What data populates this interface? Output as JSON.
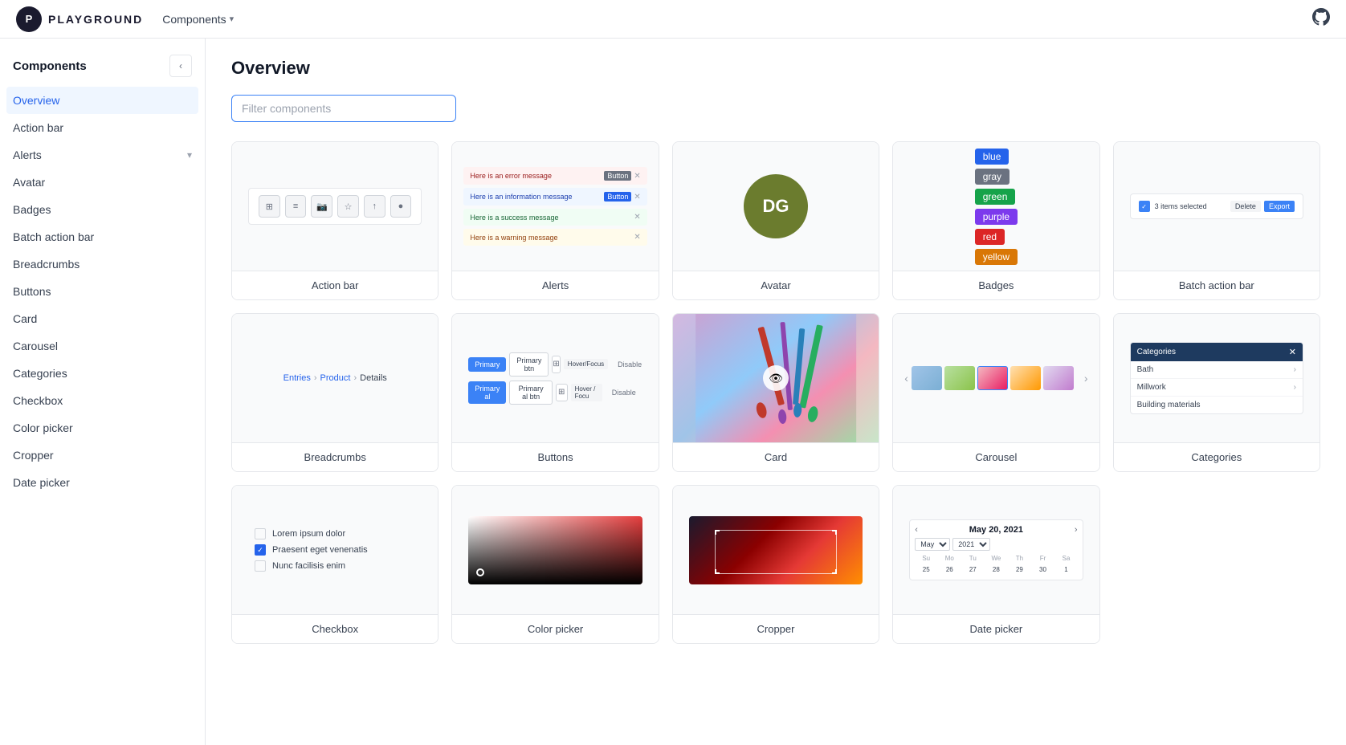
{
  "topnav": {
    "logo_text": "P",
    "brand": "PLAYGROUND",
    "nav_item": "Components",
    "nav_chevron": "▾"
  },
  "sidebar": {
    "title": "Components",
    "items": [
      {
        "label": "Overview",
        "active": true
      },
      {
        "label": "Action bar",
        "active": false
      },
      {
        "label": "Alerts",
        "active": false,
        "has_chevron": true
      },
      {
        "label": "Avatar",
        "active": false
      },
      {
        "label": "Badges",
        "active": false
      },
      {
        "label": "Batch action bar",
        "active": false
      },
      {
        "label": "Breadcrumbs",
        "active": false
      },
      {
        "label": "Buttons",
        "active": false
      },
      {
        "label": "Card",
        "active": false
      },
      {
        "label": "Carousel",
        "active": false
      },
      {
        "label": "Categories",
        "active": false
      },
      {
        "label": "Checkbox",
        "active": false
      },
      {
        "label": "Color picker",
        "active": false
      },
      {
        "label": "Cropper",
        "active": false
      },
      {
        "label": "Date picker",
        "active": false
      }
    ]
  },
  "content": {
    "title": "Overview",
    "filter_placeholder": "Filter components",
    "cards": [
      {
        "label": "Action bar"
      },
      {
        "label": "Alerts"
      },
      {
        "label": "Avatar"
      },
      {
        "label": "Badges"
      },
      {
        "label": "Batch action bar"
      },
      {
        "label": "Breadcrumbs"
      },
      {
        "label": "Buttons"
      },
      {
        "label": "Card"
      },
      {
        "label": "Carousel"
      },
      {
        "label": "Categories"
      },
      {
        "label": "Checkbox"
      },
      {
        "label": "Color picker"
      },
      {
        "label": "Cropper"
      },
      {
        "label": "Date picker"
      }
    ]
  },
  "previews": {
    "avatar_initials": "DG",
    "badges": [
      "blue",
      "gray",
      "green",
      "purple",
      "red",
      "yellow"
    ],
    "alerts": [
      {
        "type": "error",
        "text": "Here is an error message",
        "has_btn": false
      },
      {
        "type": "info",
        "text": "Here is an information message",
        "has_btn": true
      },
      {
        "type": "success",
        "text": "Here is a success message",
        "has_btn": false
      },
      {
        "type": "warning",
        "text": "Here is a warning message",
        "has_btn": false
      }
    ],
    "breadcrumbs": [
      "Entries",
      "Product",
      "Details"
    ],
    "categories": {
      "header": "Categories",
      "items": [
        "Bath",
        "Millwork",
        "Building materials"
      ]
    },
    "datepicker": {
      "month": "May 20, 2021",
      "month_select": "May",
      "year_select": "2021",
      "days_header": [
        "Su",
        "Mo",
        "Tu",
        "We",
        "Th",
        "Fr",
        "Sa"
      ],
      "days": [
        "25",
        "26",
        "27",
        "28",
        "29",
        "30",
        "1"
      ]
    }
  }
}
